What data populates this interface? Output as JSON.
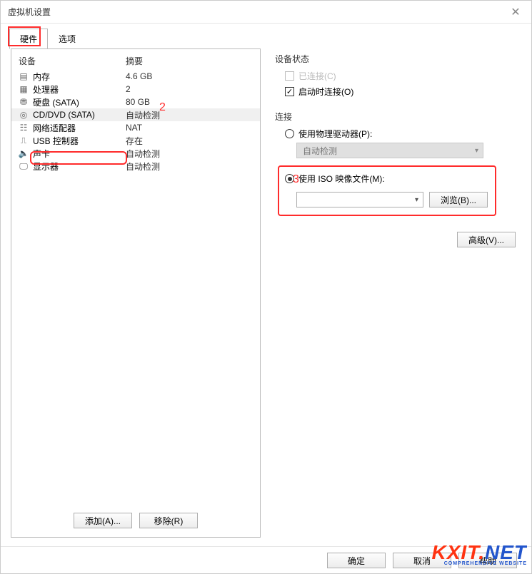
{
  "window": {
    "title": "虚拟机设置"
  },
  "tabs": {
    "hardware": "硬件",
    "options": "选项"
  },
  "headers": {
    "device": "设备",
    "summary": "摘要"
  },
  "rows": [
    {
      "name": "内存",
      "summary": "4.6 GB"
    },
    {
      "name": "处理器",
      "summary": "2"
    },
    {
      "name": "硬盘 (SATA)",
      "summary": "80 GB"
    },
    {
      "name": "CD/DVD (SATA)",
      "summary": "自动检测"
    },
    {
      "name": "网络适配器",
      "summary": "NAT"
    },
    {
      "name": "USB 控制器",
      "summary": "存在"
    },
    {
      "name": "声卡",
      "summary": "自动检测"
    },
    {
      "name": "显示器",
      "summary": "自动检测"
    }
  ],
  "left_buttons": {
    "add": "添加(A)...",
    "remove": "移除(R)"
  },
  "status": {
    "title": "设备状态",
    "connected": "已连接(C)",
    "connect_on_power": "启动时连接(O)"
  },
  "connection": {
    "title": "连接",
    "use_physical": "使用物理驱动器(P):",
    "physical_combo": "自动检测",
    "use_iso": "使用 ISO 映像文件(M):",
    "browse": "浏览(B)...",
    "iso_path": ""
  },
  "advanced": "高级(V)...",
  "footer": {
    "ok": "确定",
    "cancel": "取消",
    "help": "帮助"
  },
  "annotations": {
    "n2": "2",
    "n3": "3"
  },
  "watermark": {
    "brand": "KXIT.NET",
    "tag": "COMPREHENSIVE WEBSITE"
  }
}
